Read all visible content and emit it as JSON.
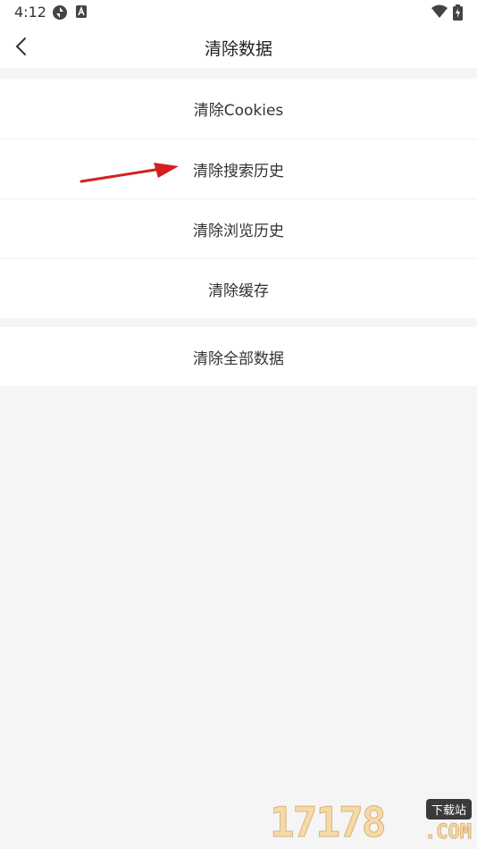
{
  "status_bar": {
    "time": "4:12",
    "icons": [
      "sync-icon",
      "a-letter-icon",
      "wifi-icon",
      "battery-charging-icon"
    ]
  },
  "header": {
    "title": "清除数据",
    "back_icon": "chevron-left-icon"
  },
  "groups": [
    {
      "items": [
        {
          "label": "清除Cookies"
        },
        {
          "label": "清除搜索历史"
        },
        {
          "label": "清除浏览历史"
        },
        {
          "label": "清除缓存"
        }
      ]
    },
    {
      "items": [
        {
          "label": "清除全部数据"
        }
      ]
    }
  ],
  "annotation": {
    "arrow_color": "#d42020"
  },
  "watermark": {
    "digits": "17178",
    "badge": "下载站",
    "suffix": ".COM"
  },
  "colors": {
    "background": "#f5f5f5",
    "surface": "#ffffff",
    "text": "#333333"
  }
}
